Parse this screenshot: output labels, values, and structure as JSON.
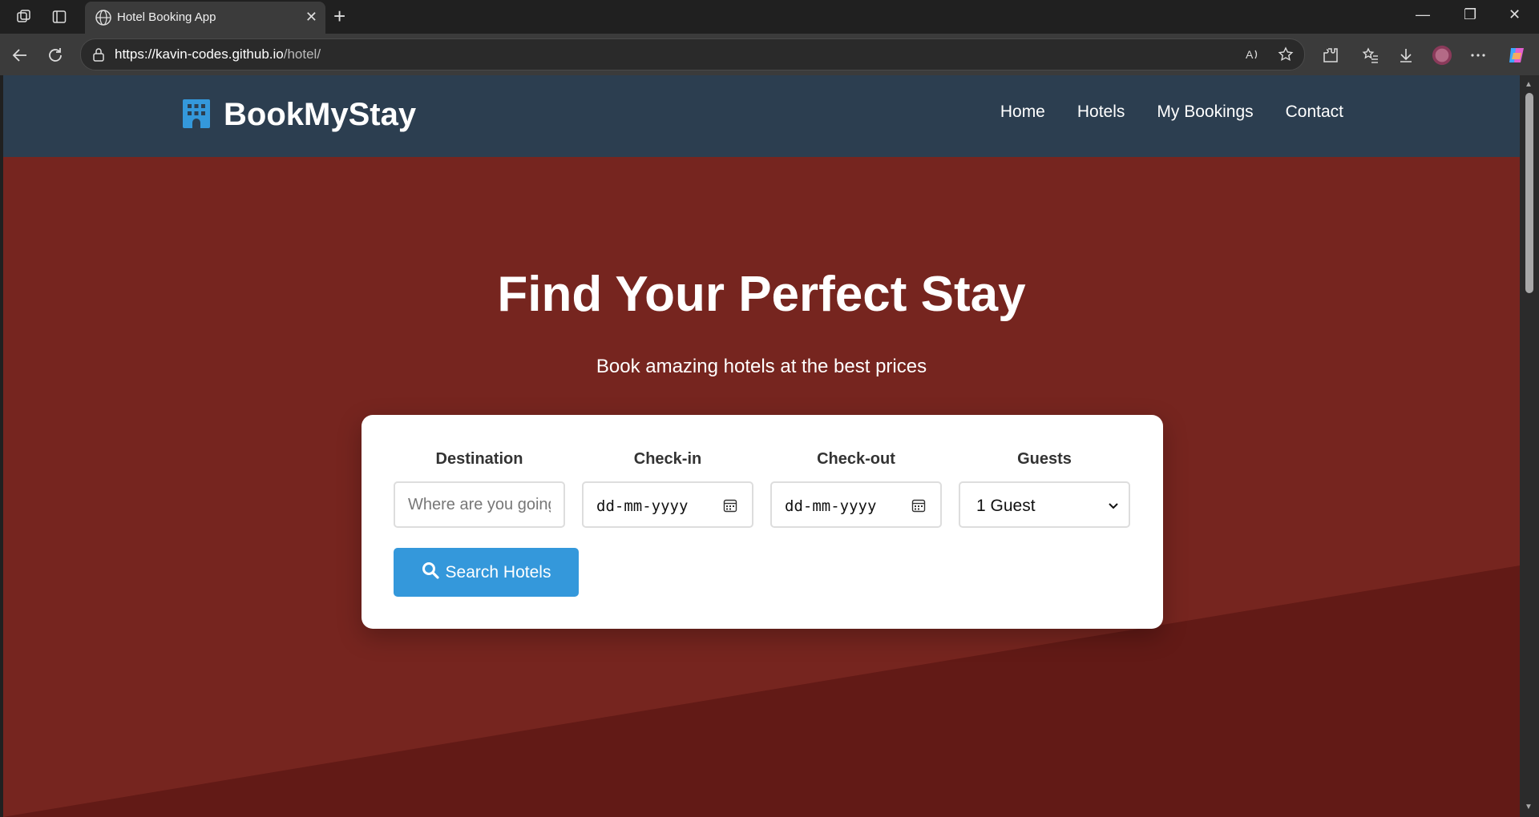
{
  "browser": {
    "tab_title": "Hotel Booking App",
    "url_host": "https://kavin-codes.github.io",
    "url_path": "/hotel/",
    "icons": [
      "workspaces-icon",
      "tab-actions-icon",
      "globe-icon",
      "close-icon",
      "new-tab-icon",
      "back-icon",
      "refresh-icon",
      "lock-icon",
      "read-aloud-icon",
      "favorite-icon",
      "extensions-icon",
      "favorites-icon",
      "downloads-icon",
      "profile-avatar",
      "more-icon",
      "copilot-icon"
    ]
  },
  "site": {
    "brand": "BookMyStay",
    "brand_icon": "hotel-building-icon",
    "nav": [
      {
        "label": "Home"
      },
      {
        "label": "Hotels"
      },
      {
        "label": "My Bookings"
      },
      {
        "label": "Contact"
      }
    ],
    "colors": {
      "header_bg": "#2c3e50",
      "hero_bg": "#76251f",
      "accent": "#3498db"
    }
  },
  "hero": {
    "title": "Find Your Perfect Stay",
    "subtitle": "Book amazing hotels at the best prices"
  },
  "search": {
    "destination": {
      "label": "Destination",
      "placeholder": "Where are you going?",
      "value": ""
    },
    "checkin": {
      "label": "Check-in",
      "placeholder": "dd-mm-yyyy"
    },
    "checkout": {
      "label": "Check-out",
      "placeholder": "dd-mm-yyyy"
    },
    "guests": {
      "label": "Guests",
      "selected": "1 Guest"
    },
    "button_label": "Search Hotels"
  }
}
